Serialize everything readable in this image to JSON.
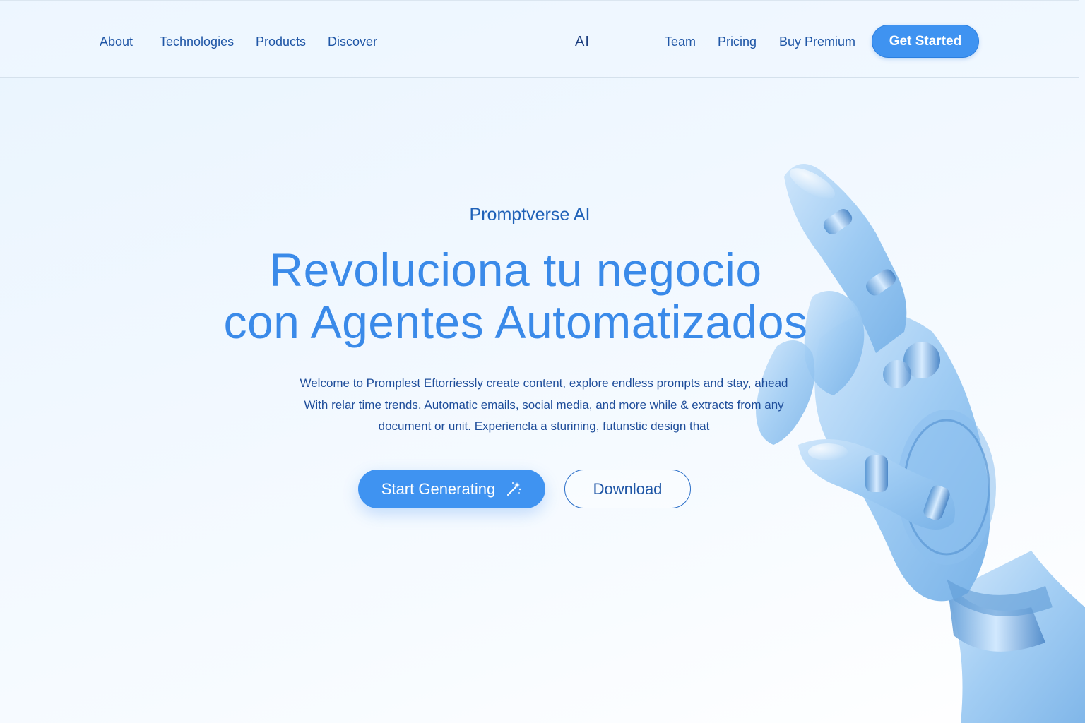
{
  "nav": {
    "left_links": [
      "About",
      "Technologies",
      "Products",
      "Discover"
    ],
    "brand": "AI",
    "right_links": [
      "Team",
      "Pricing",
      "Buy Premium"
    ],
    "cta": "Get Started"
  },
  "hero": {
    "eyebrow": "Promptverse AI",
    "headline_line1": "Revoluciona tu negocio",
    "headline_line2": "con Agentes Automatizados",
    "body_line1": "Welcome to Promplest Eftorriessly create content, explore endless prompts and stay, ahead",
    "body_line2": "With relar time trends. Automatic emails, social media, and more while & extracts from any",
    "body_line3": "document or unit. Experiencla a sturining, futunstic design that",
    "primary_button": "Start Generating",
    "primary_button_icon": "magic-wand-icon",
    "secondary_button": "Download"
  },
  "colors": {
    "accent": "#3f93f1",
    "nav_text": "#1f56a6",
    "headline": "#3a8ae9",
    "body_text": "#1e4d9a"
  }
}
